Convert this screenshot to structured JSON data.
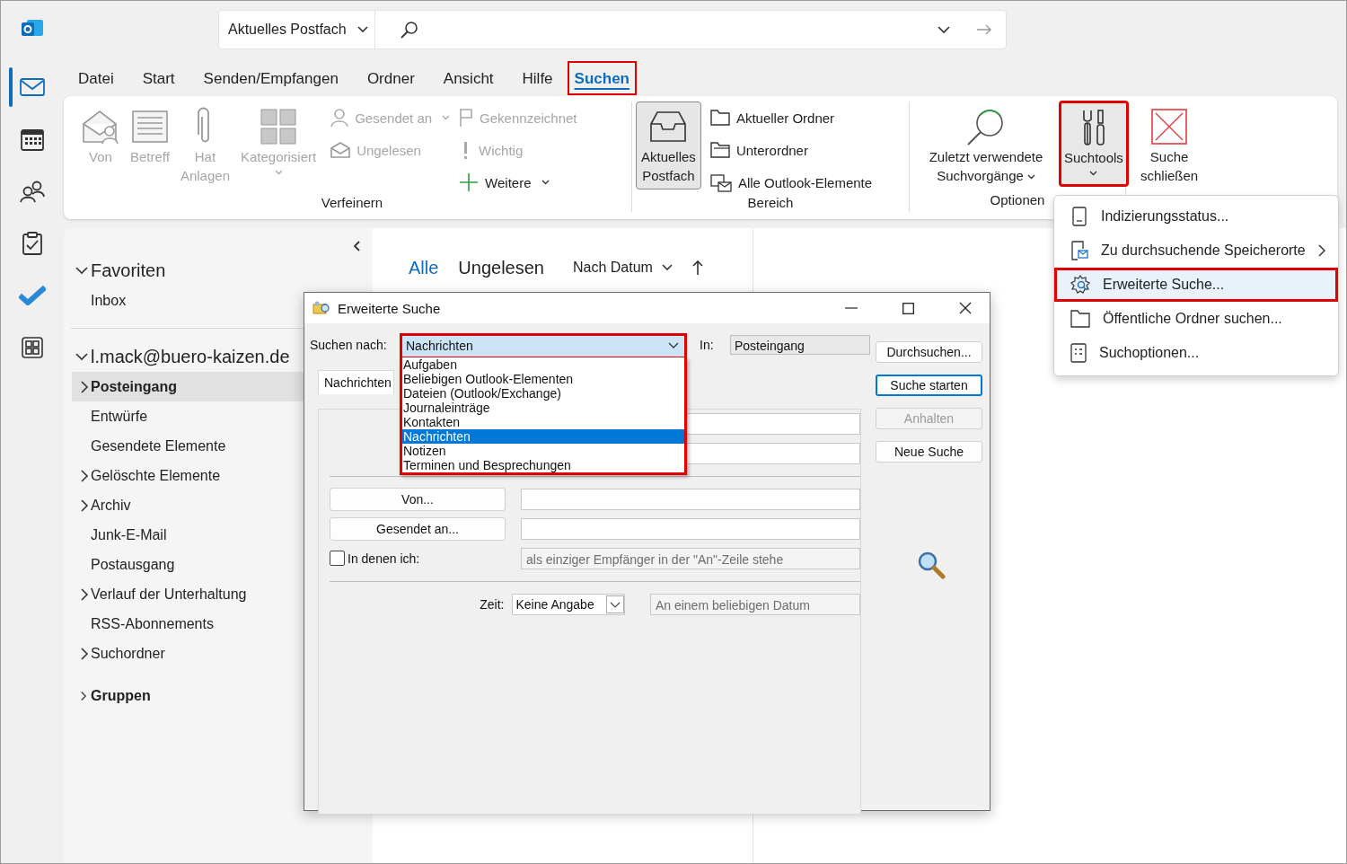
{
  "app_rail": [
    {
      "selected": true
    },
    {
      "selected": false
    },
    {
      "selected": false
    },
    {
      "selected": false
    },
    {
      "selected": false
    },
    {
      "selected": false
    }
  ],
  "search": {
    "scope": "Aktuelles Postfach"
  },
  "menu_tabs": [
    {
      "label": "Datei",
      "selected": false,
      "highlighted": false
    },
    {
      "label": "Start",
      "selected": false,
      "highlighted": false
    },
    {
      "label": "Senden/Empfangen",
      "selected": false,
      "highlighted": false
    },
    {
      "label": "Ordner",
      "selected": false,
      "highlighted": false
    },
    {
      "label": "Ansicht",
      "selected": false,
      "highlighted": false
    },
    {
      "label": "Hilfe",
      "selected": false,
      "highlighted": false
    },
    {
      "label": "Suchen",
      "selected": true,
      "highlighted": true
    }
  ],
  "ribbon": {
    "refine": {
      "label": "Verfeinern",
      "large": [
        {
          "label": "Von",
          "disabled": true,
          "dropdown": false
        },
        {
          "label": "Betreff",
          "disabled": true,
          "dropdown": false
        },
        {
          "label": "Hat Anlagen",
          "disabled": true,
          "dropdown": false
        },
        {
          "label": "Kategorisiert",
          "disabled": true,
          "dropdown": true
        }
      ],
      "small": [
        {
          "label": "Gesendet an",
          "disabled": true,
          "dropdown": true
        },
        {
          "label": "Ungelesen",
          "disabled": true,
          "dropdown": false
        },
        {
          "label": "Gekennzeichnet",
          "disabled": true,
          "dropdown": false
        },
        {
          "label": "Wichtig",
          "disabled": true,
          "dropdown": false
        },
        {
          "label": "Weitere",
          "disabled": false,
          "dropdown": true
        }
      ]
    },
    "scope": {
      "label": "Bereich",
      "current": {
        "label": "Aktuelles Postfach",
        "selected": true
      },
      "small": [
        {
          "label": "Aktueller Ordner"
        },
        {
          "label": "Unterordner"
        },
        {
          "label": "Alle Outlook-Elemente"
        }
      ]
    },
    "options": {
      "label": "Optionen",
      "recent": {
        "label": "Zuletzt verwendete Suchvorgänge"
      },
      "tools": {
        "label": "Suchtools",
        "highlighted": true
      }
    },
    "close": {
      "label": "Suche schließen"
    }
  },
  "folders": [
    {
      "label": "Favoriten",
      "kind": "header",
      "expanded": true,
      "children": [
        {
          "label": "Inbox",
          "selected": false,
          "expandable": false
        }
      ]
    },
    {
      "label": "l.mack@buero-kaizen.de",
      "kind": "header",
      "expanded": true,
      "children": [
        {
          "label": "Posteingang",
          "selected": true,
          "expandable": true
        },
        {
          "label": "Entwürfe",
          "selected": false,
          "expandable": false
        },
        {
          "label": "Gesendete Elemente",
          "selected": false,
          "expandable": false
        },
        {
          "label": "Gelöschte Elemente",
          "selected": false,
          "expandable": true
        },
        {
          "label": "Archiv",
          "selected": false,
          "expandable": true
        },
        {
          "label": "Junk-E-Mail",
          "selected": false,
          "expandable": false
        },
        {
          "label": "Postausgang",
          "selected": false,
          "expandable": false
        },
        {
          "label": "Verlauf der Unterhaltung",
          "selected": false,
          "expandable": true
        },
        {
          "label": "RSS-Abonnements",
          "selected": false,
          "expandable": false
        },
        {
          "label": "Suchordner",
          "selected": false,
          "expandable": true
        }
      ]
    },
    {
      "label": "Gruppen",
      "kind": "group",
      "expanded": false
    }
  ],
  "message_list": {
    "filters": [
      {
        "label": "Alle",
        "selected": true
      },
      {
        "label": "Ungelesen",
        "selected": false
      }
    ],
    "sort": "Nach Datum"
  },
  "dialog": {
    "title": "Erweiterte Suche",
    "search_for_label": "Suchen nach:",
    "search_for": {
      "value": "Nachrichten",
      "expanded": true,
      "highlighted": true,
      "options": [
        {
          "label": "Aufgaben",
          "selected": false
        },
        {
          "label": "Beliebigen Outlook-Elementen",
          "selected": false
        },
        {
          "label": "Dateien (Outlook/Exchange)",
          "selected": false
        },
        {
          "label": "Journaleinträge",
          "selected": false
        },
        {
          "label": "Kontakten",
          "selected": false
        },
        {
          "label": "Nachrichten",
          "selected": true
        },
        {
          "label": "Notizen",
          "selected": false
        },
        {
          "label": "Terminen und Besprechungen",
          "selected": false
        }
      ]
    },
    "in_label": "In:",
    "in_value": "Posteingang",
    "buttons": [
      {
        "label": "Durchsuchen...",
        "default": false,
        "disabled": false
      },
      {
        "label": "Suche starten",
        "default": true,
        "disabled": false
      },
      {
        "label": "Anhalten",
        "default": false,
        "disabled": true
      },
      {
        "label": "Neue Suche",
        "default": false,
        "disabled": false
      }
    ],
    "tab": "Nachrichten",
    "from_button": "Von...",
    "sent_to_button": "Gesendet an...",
    "where_i": {
      "label": "In denen ich:",
      "checked": false,
      "value": "als einziger Empfänger in der \"An\"-Zeile stehe"
    },
    "time_label": "Zeit:",
    "time_value": "Keine Angabe",
    "date_value": "An einem beliebigen Datum"
  },
  "tools_menu": [
    {
      "label": "Indizierungsstatus...",
      "selected": false,
      "highlighted": false,
      "submenu": false
    },
    {
      "label": "Zu durchsuchende Speicherorte",
      "selected": false,
      "highlighted": false,
      "submenu": true
    },
    {
      "label": "Erweiterte Suche...",
      "selected": true,
      "highlighted": true,
      "submenu": false
    },
    {
      "label": "Öffentliche Ordner suchen...",
      "selected": false,
      "highlighted": false,
      "submenu": false
    },
    {
      "label": "Suchoptionen...",
      "selected": false,
      "highlighted": false,
      "submenu": false
    }
  ]
}
